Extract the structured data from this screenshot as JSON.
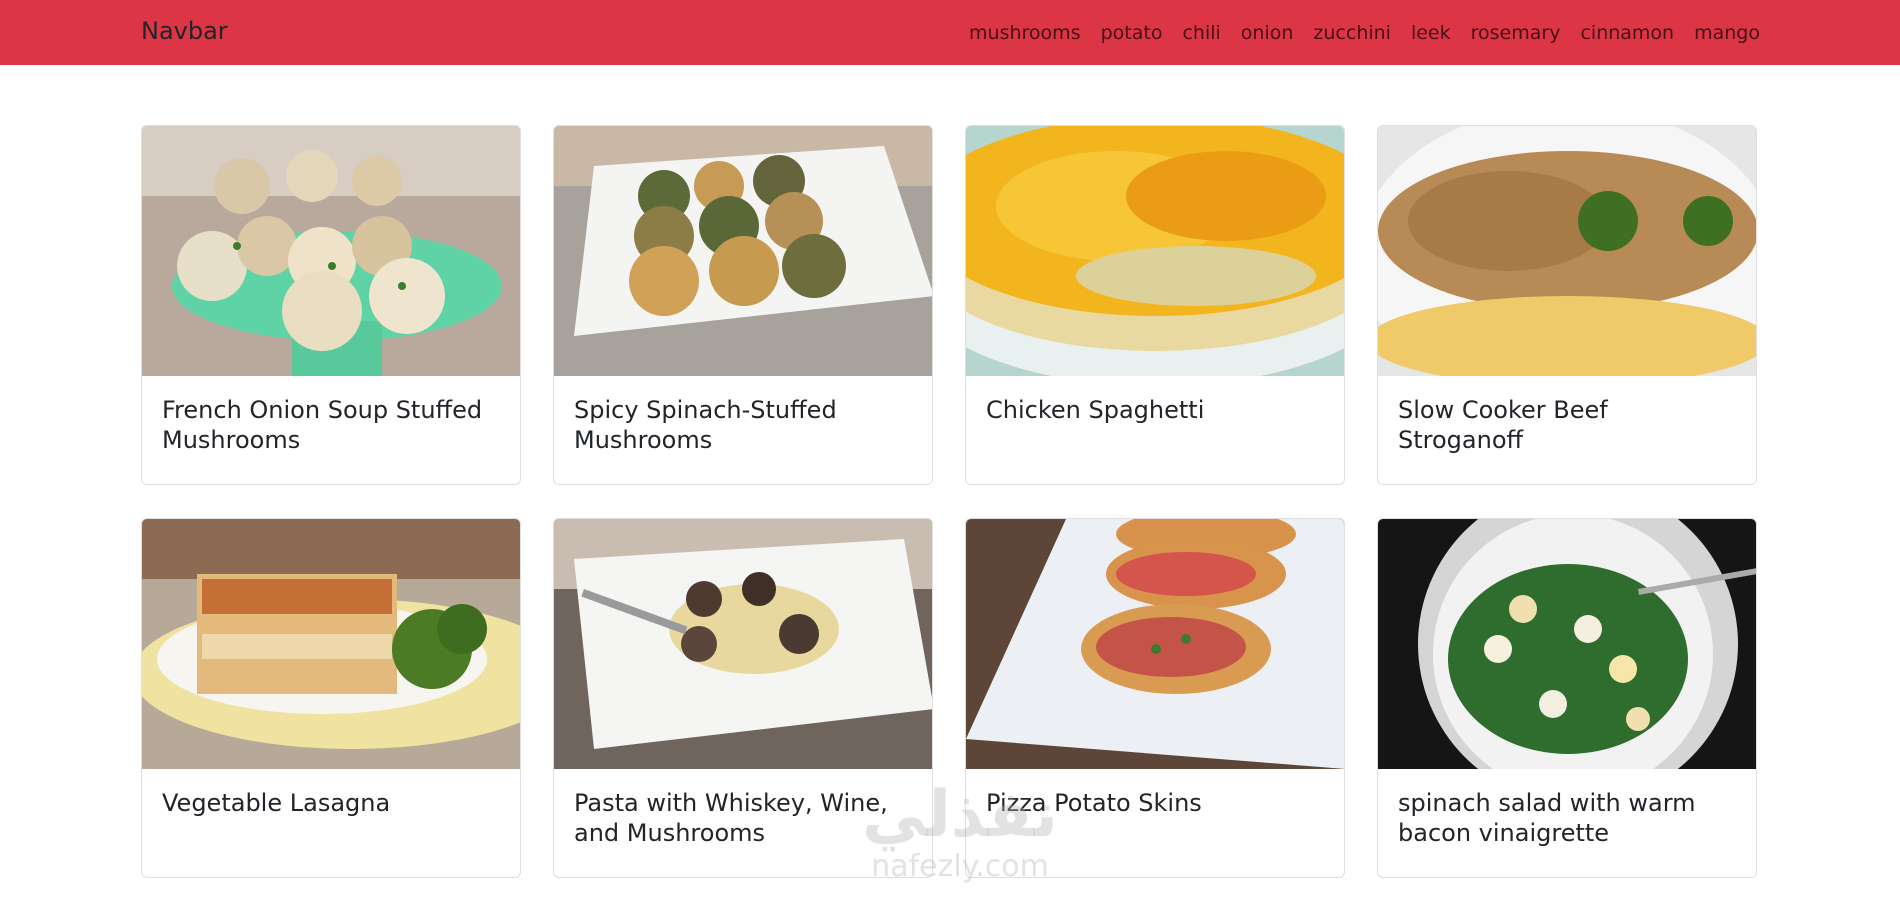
{
  "colors": {
    "brand": "#dc3545"
  },
  "navbar": {
    "brand": "Navbar",
    "links": [
      "mushrooms",
      "potato",
      "chili",
      "onion",
      "zucchini",
      "leek",
      "rosemary",
      "cinnamon",
      "mango"
    ]
  },
  "cards": [
    {
      "title": "French Onion Soup Stuffed Mushrooms"
    },
    {
      "title": "Spicy Spinach-Stuffed Mushrooms"
    },
    {
      "title": "Chicken Spaghetti"
    },
    {
      "title": "Slow Cooker Beef Stroganoff"
    },
    {
      "title": "Vegetable Lasagna"
    },
    {
      "title": "Pasta with Whiskey, Wine, and Mushrooms"
    },
    {
      "title": "Pizza Potato Skins"
    },
    {
      "title": "spinach salad with warm bacon vinaigrette"
    }
  ],
  "watermark": {
    "arabic": "نفذلي",
    "latin": "nafezly.com"
  }
}
